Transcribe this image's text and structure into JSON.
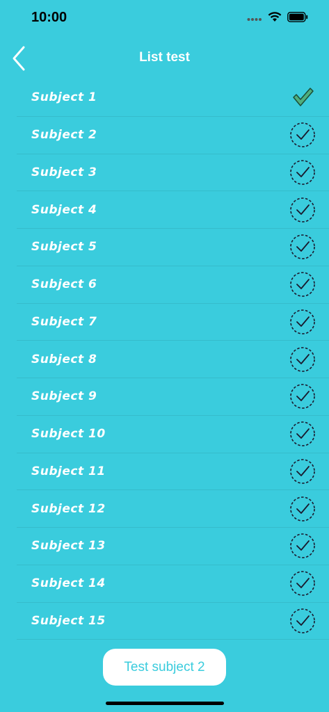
{
  "status_bar": {
    "time": "10:00"
  },
  "nav": {
    "title": "List test",
    "back_icon": "chevron-left-icon"
  },
  "list": {
    "items": [
      {
        "label": "Subject 1",
        "state": "checked"
      },
      {
        "label": "Subject 2",
        "state": "unchecked"
      },
      {
        "label": "Subject 3",
        "state": "unchecked"
      },
      {
        "label": "Subject 4",
        "state": "unchecked"
      },
      {
        "label": "Subject 5",
        "state": "unchecked"
      },
      {
        "label": "Subject 6",
        "state": "unchecked"
      },
      {
        "label": "Subject 7",
        "state": "unchecked"
      },
      {
        "label": "Subject 8",
        "state": "unchecked"
      },
      {
        "label": "Subject 9",
        "state": "unchecked"
      },
      {
        "label": "Subject 10",
        "state": "unchecked"
      },
      {
        "label": "Subject 11",
        "state": "unchecked"
      },
      {
        "label": "Subject 12",
        "state": "unchecked"
      },
      {
        "label": "Subject 13",
        "state": "unchecked"
      },
      {
        "label": "Subject 14",
        "state": "unchecked"
      },
      {
        "label": "Subject 15",
        "state": "unchecked"
      }
    ]
  },
  "action_button": {
    "label": "Test subject 2"
  },
  "colors": {
    "background": "#3ACCDD",
    "checked_fill": "#4FAF7E",
    "unchecked_stroke": "#1A1A2E",
    "button_text": "#3ACCDD"
  }
}
